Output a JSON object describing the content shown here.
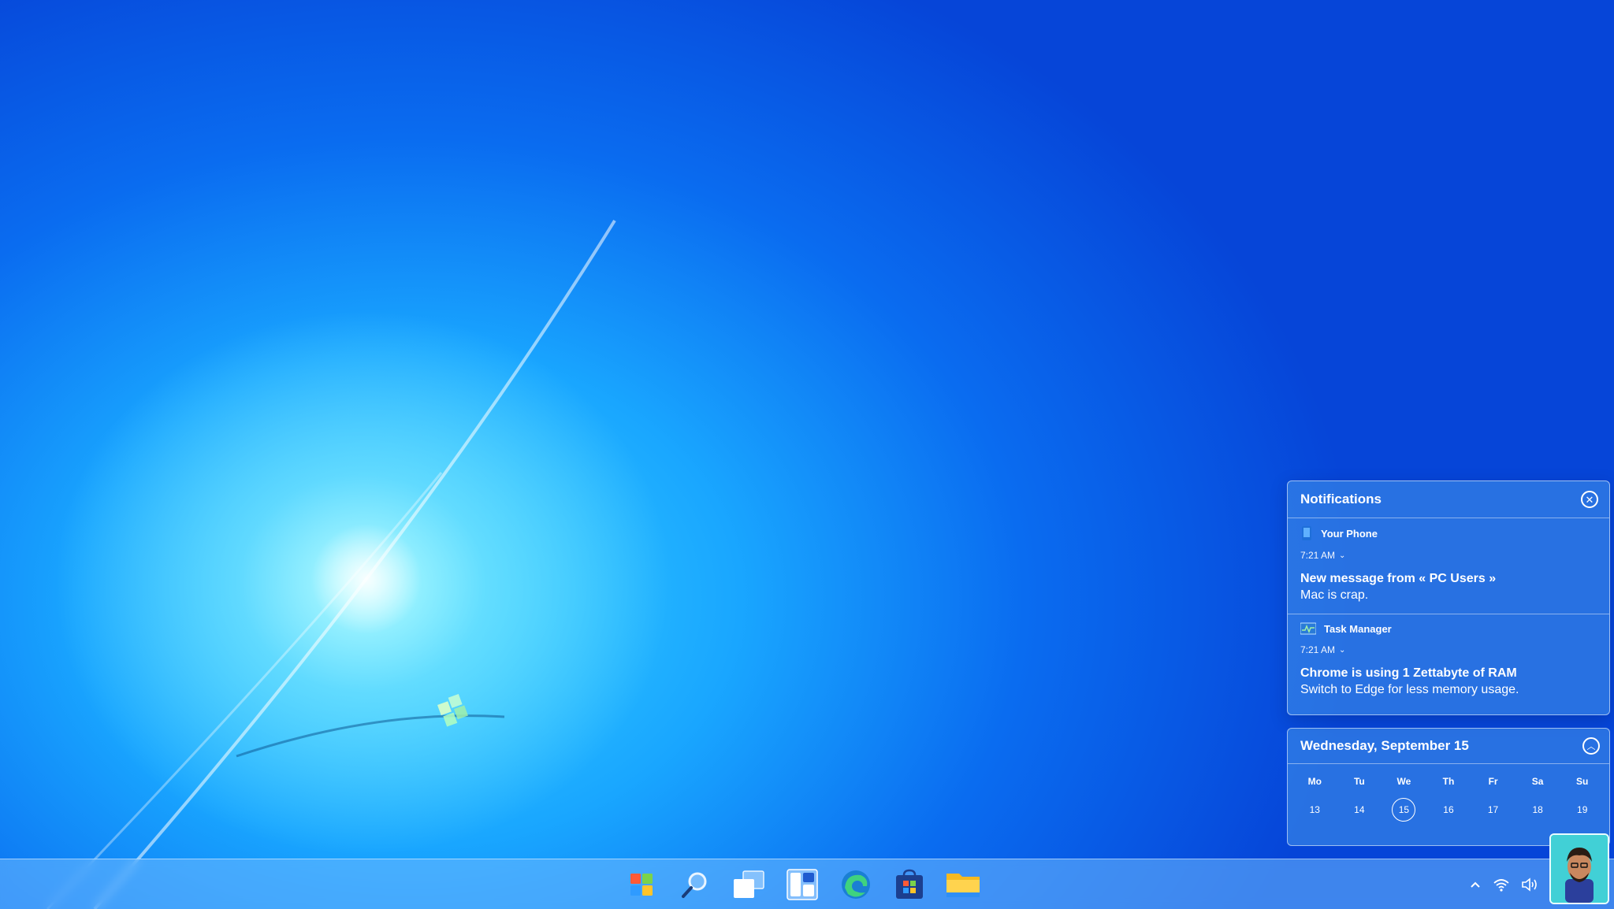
{
  "notifications": {
    "title": "Notifications",
    "items": [
      {
        "app": "Your Phone",
        "icon": "phone-icon",
        "time": "7:21 AM",
        "title": "New message from « PC Users »",
        "body": "Mac is crap."
      },
      {
        "app": "Task Manager",
        "icon": "task-manager-icon",
        "time": "7:21 AM",
        "title": "Chrome is using 1 Zettabyte of RAM",
        "body": "Switch to Edge for less memory usage."
      }
    ]
  },
  "calendar": {
    "date": "Wednesday, September 15",
    "weekdays": [
      "Mo",
      "Tu",
      "We",
      "Th",
      "Fr",
      "Sa",
      "Su"
    ],
    "days": [
      "13",
      "14",
      "15",
      "16",
      "17",
      "18",
      "19"
    ],
    "today": "15"
  },
  "taskbar": {
    "apps": [
      "start-icon",
      "search-icon",
      "task-view-icon",
      "widgets-icon",
      "edge-icon",
      "store-icon",
      "file-explorer-icon"
    ],
    "tray": [
      "chevron-up-icon",
      "wifi-icon",
      "volume-icon",
      "battery-icon"
    ]
  },
  "colors": {
    "accent": "#0a6cf0",
    "panel": "#4696eb"
  }
}
